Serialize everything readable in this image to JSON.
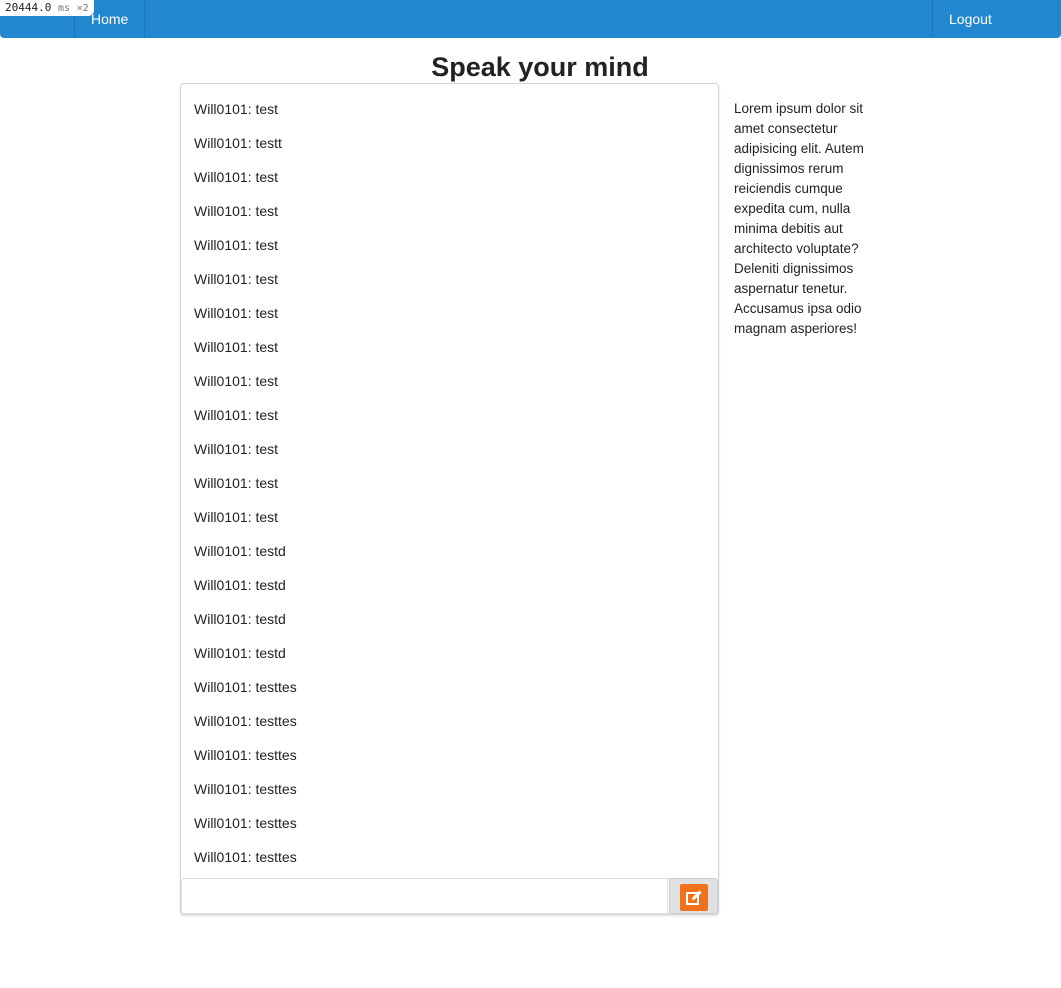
{
  "debug": {
    "timer_value": "20444.0",
    "timer_unit": "ms",
    "timer_multiplier": "×2"
  },
  "nav": {
    "home_label": "Home",
    "logout_label": "Logout",
    "color": "#2188d0"
  },
  "page": {
    "title": "Speak your mind"
  },
  "chat": {
    "messages": [
      "Will0101: test",
      "Will0101: testt",
      "Will0101: test",
      "Will0101: test",
      "Will0101: test",
      "Will0101: test",
      "Will0101: test",
      "Will0101: test",
      "Will0101: test",
      "Will0101: test",
      "Will0101: test",
      "Will0101: test",
      "Will0101: test",
      "Will0101: testd",
      "Will0101: testd",
      "Will0101: testd",
      "Will0101: testd",
      "Will0101: testtes",
      "Will0101: testtes",
      "Will0101: testtes",
      "Will0101: testtes",
      "Will0101: testtes",
      "Will0101: testtes"
    ],
    "input_value": "",
    "send_icon": "edit-icon",
    "send_icon_color": "#f2711c"
  },
  "sidebar": {
    "text": "Lorem ipsum dolor sit amet consectetur adipisicing elit. Autem dignissimos rerum reiciendis cumque expedita cum, nulla minima debitis aut architecto voluptate? Deleniti dignissimos aspernatur tenetur. Accusamus ipsa odio magnam asperiores!"
  }
}
